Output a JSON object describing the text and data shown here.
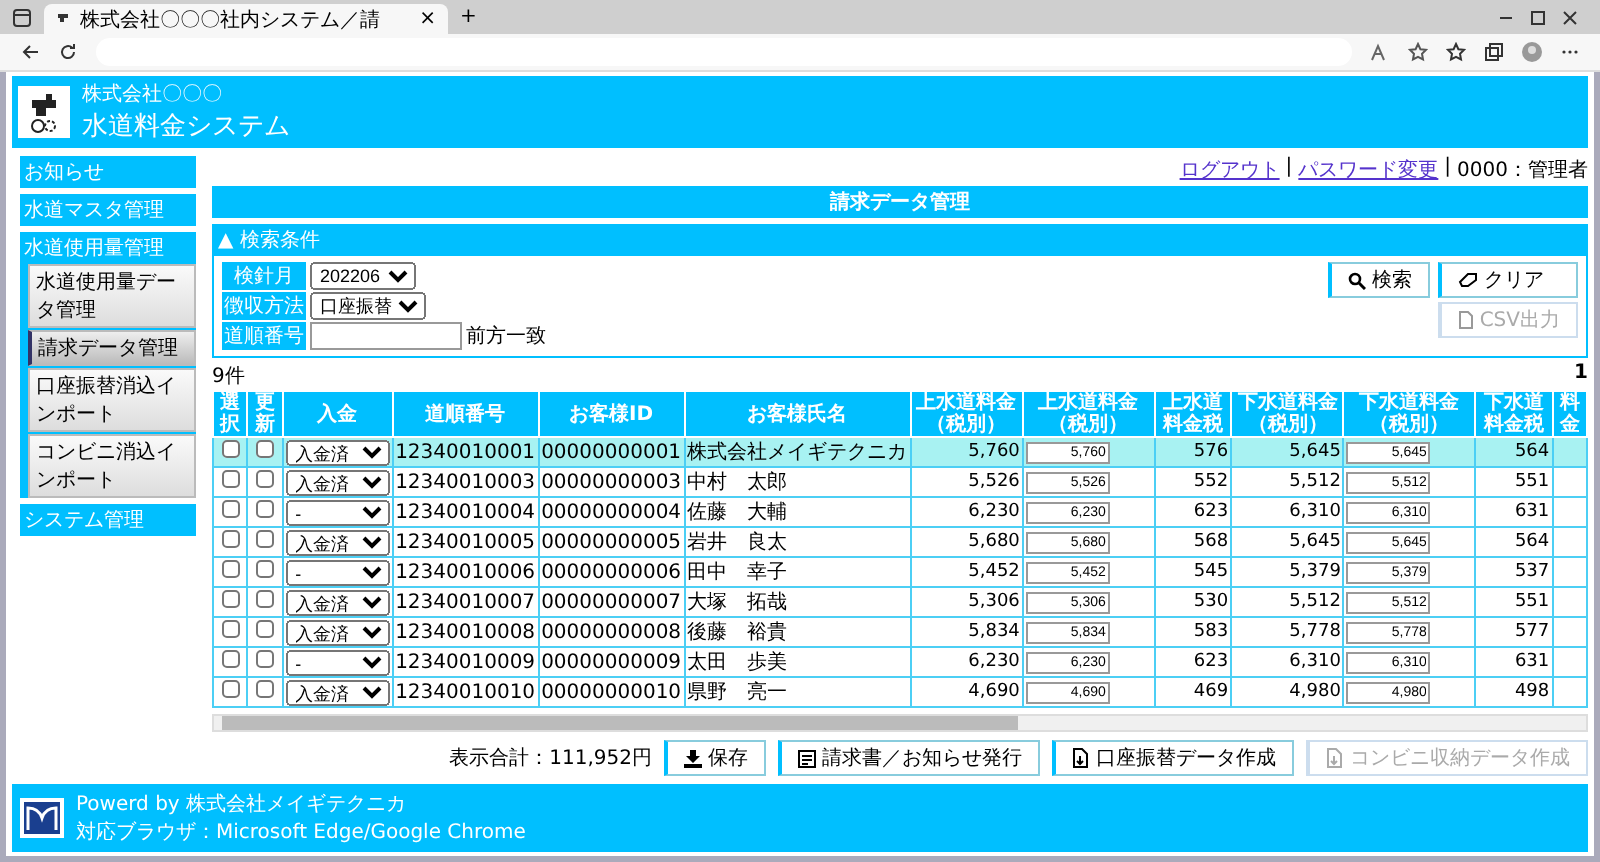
{
  "browser": {
    "tab_title": "株式会社〇〇〇社内システム／請",
    "close": "×",
    "new_tab": "+"
  },
  "header": {
    "company": "株式会社〇〇〇",
    "system": "水道料金システム"
  },
  "sidebar": {
    "items": [
      {
        "label": "お知らせ"
      },
      {
        "label": "水道マスタ管理"
      },
      {
        "label": "水道使用量管理",
        "children": [
          {
            "label": "水道使用量データ管理",
            "selected": false
          },
          {
            "label": "請求データ管理",
            "selected": true
          },
          {
            "label": "口座振替消込インポート",
            "selected": false
          },
          {
            "label": "コンビニ消込インポート",
            "selected": false
          }
        ]
      },
      {
        "label": "システム管理"
      }
    ]
  },
  "user_bar": {
    "links": [
      "ログアウト",
      "パスワード変更"
    ],
    "separator": "|",
    "user": "0000：管理者"
  },
  "page_title": "請求データ管理",
  "search": {
    "toggle": "▲",
    "title": "検索条件",
    "fields": [
      {
        "label": "検針月",
        "kind": "select",
        "value": "202206"
      },
      {
        "label": "徴収方法",
        "kind": "select",
        "value": "口座振替"
      },
      {
        "label": "道順番号",
        "kind": "text",
        "hint": "前方一致"
      }
    ],
    "buttons": [
      {
        "label": "検索",
        "kind": "search",
        "disabled": false
      },
      {
        "label": "クリア",
        "kind": "clear",
        "disabled": false
      },
      {
        "label": "CSV出力",
        "kind": "csv",
        "disabled": true
      }
    ]
  },
  "results": {
    "count": "9件",
    "page": "1",
    "columns": [
      "選択",
      "更新",
      "入金",
      "道順番号",
      "お客様ID",
      "お客様氏名",
      "上水道料金（税別）",
      "上水道料金（税別）",
      "上水道料金税",
      "下水道料金（税別）",
      "下水道料金（税別）",
      "下水道料金税",
      "料金"
    ],
    "rows": [
      {
        "selected": true,
        "pick": false,
        "update": false,
        "payment": "入金済",
        "route_no": "12340010001",
        "customer_id": "00000000001",
        "name": "株式会社メイギテクニカ",
        "water_fee": "5,760",
        "water_input": "5,760",
        "water_tax": "576",
        "sewer_fee": "5,645",
        "sewer_input": "5,645",
        "sewer_tax": "564"
      },
      {
        "selected": false,
        "pick": false,
        "update": false,
        "payment": "入金済",
        "route_no": "12340010003",
        "customer_id": "00000000003",
        "name": "中村　太郎",
        "water_fee": "5,526",
        "water_input": "5,526",
        "water_tax": "552",
        "sewer_fee": "5,512",
        "sewer_input": "5,512",
        "sewer_tax": "551"
      },
      {
        "selected": false,
        "pick": false,
        "update": false,
        "payment": "-",
        "route_no": "12340010004",
        "customer_id": "00000000004",
        "name": "佐藤　大輔",
        "water_fee": "6,230",
        "water_input": "6,230",
        "water_tax": "623",
        "sewer_fee": "6,310",
        "sewer_input": "6,310",
        "sewer_tax": "631"
      },
      {
        "selected": false,
        "pick": false,
        "update": false,
        "payment": "入金済",
        "route_no": "12340010005",
        "customer_id": "00000000005",
        "name": "岩井　良太",
        "water_fee": "5,680",
        "water_input": "5,680",
        "water_tax": "568",
        "sewer_fee": "5,645",
        "sewer_input": "5,645",
        "sewer_tax": "564"
      },
      {
        "selected": false,
        "pick": false,
        "update": false,
        "payment": "-",
        "route_no": "12340010006",
        "customer_id": "00000000006",
        "name": "田中　幸子",
        "water_fee": "5,452",
        "water_input": "5,452",
        "water_tax": "545",
        "sewer_fee": "5,379",
        "sewer_input": "5,379",
        "sewer_tax": "537"
      },
      {
        "selected": false,
        "pick": false,
        "update": false,
        "payment": "入金済",
        "route_no": "12340010007",
        "customer_id": "00000000007",
        "name": "大塚　拓哉",
        "water_fee": "5,306",
        "water_input": "5,306",
        "water_tax": "530",
        "sewer_fee": "5,512",
        "sewer_input": "5,512",
        "sewer_tax": "551"
      },
      {
        "selected": false,
        "pick": false,
        "update": false,
        "payment": "入金済",
        "route_no": "12340010008",
        "customer_id": "00000000008",
        "name": "後藤　裕貴",
        "water_fee": "5,834",
        "water_input": "5,834",
        "water_tax": "583",
        "sewer_fee": "5,778",
        "sewer_input": "5,778",
        "sewer_tax": "577"
      },
      {
        "selected": false,
        "pick": false,
        "update": false,
        "payment": "-",
        "route_no": "12340010009",
        "customer_id": "00000000009",
        "name": "太田　歩美",
        "water_fee": "6,230",
        "water_input": "6,230",
        "water_tax": "623",
        "sewer_fee": "6,310",
        "sewer_input": "6,310",
        "sewer_tax": "631"
      },
      {
        "selected": false,
        "pick": false,
        "update": false,
        "payment": "入金済",
        "route_no": "12340010010",
        "customer_id": "00000000010",
        "name": "県野　亮一",
        "water_fee": "4,690",
        "water_input": "4,690",
        "water_tax": "469",
        "sewer_fee": "4,980",
        "sewer_input": "4,980",
        "sewer_tax": "498"
      }
    ]
  },
  "action_bar": {
    "total": "表示合計：111,952円",
    "buttons": [
      {
        "label": "保存",
        "kind": "save",
        "disabled": false
      },
      {
        "label": "請求書／お知らせ発行",
        "kind": "invoice",
        "disabled": false
      },
      {
        "label": "口座振替データ作成",
        "kind": "file",
        "disabled": false
      },
      {
        "label": "コンビニ収納データ作成",
        "kind": "file",
        "disabled": true
      }
    ]
  },
  "footer": {
    "powered": "Powerd by 株式会社メイギテクニカ",
    "browsers": "対応ブラウザ：Microsoft Edge/Google Chrome"
  }
}
